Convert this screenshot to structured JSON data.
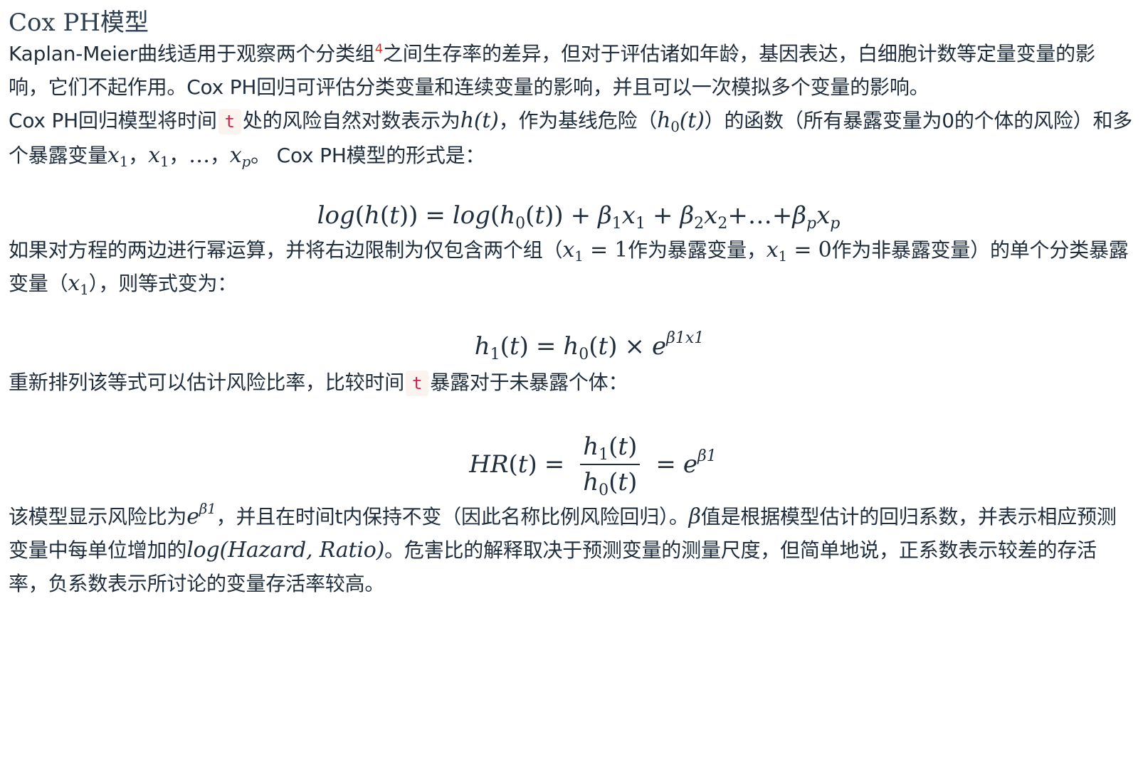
{
  "title": "Cox PH模型",
  "p1": {
    "a": "Kaplan-Meier曲线适用于观察两个分类组",
    "footnote": "4",
    "b": "之间生存率的差异，但对于评估诸如年龄，基因表达，白细胞计数等定量变量的影响，它们不起作用。Cox PH回归可评估分类变量和连续变量的影响，并且可以一次模拟多个变量的影响。"
  },
  "p2": {
    "a": "Cox PH回归模型将时间",
    "code": "t",
    "b": "处的风险自然对数表示为",
    "m1": "h(t)",
    "c": "，作为基线危险（",
    "m2_base": "h",
    "m2_sub": "0",
    "m2_tail": "(t)",
    "d": "）的函数（所有暴露变量为0的个体的风险）和多个暴露变量",
    "x": "x",
    "sub1": "1",
    "sep": "，",
    "dots": "…",
    "subp": "p",
    "e": "。 Cox PH模型的形式是："
  },
  "eq1": {
    "log": "log",
    "h": "h",
    "t": "t",
    "sub0": "0",
    "beta": "β",
    "x": "x",
    "s1": "1",
    "s2": "2",
    "sp": "p",
    "dots": "…"
  },
  "p3": {
    "a": "如果对方程的两边进行幂运算，并将右边限制为仅包含两个组（",
    "x": "x",
    "sub": "1",
    "eq": " = 1",
    "b": "作为暴露变量，",
    "eq0": " = 0",
    "c": "作为非暴露变量）的单个分类暴露变量（",
    "d": "），则等式变为："
  },
  "eq2": {
    "h": "h",
    "t": "t",
    "s1": "1",
    "s0": "0",
    "times": "×",
    "e": "e",
    "exp": "β1x1"
  },
  "p4": {
    "a": "重新排列该等式可以估计风险比率，比较时间",
    "code": "t",
    "b": "暴露对于未暴露个体："
  },
  "eq3": {
    "hr": "HR",
    "t": "t",
    "h": "h",
    "s1": "1",
    "s0": "0",
    "e": "e",
    "exp": "β1"
  },
  "p5": {
    "a": "该模型显示风险比为",
    "e": "e",
    "exp": "β1",
    "b": "，并且在时间t内保持不变（因此名称比例风险回归）。",
    "beta": "β",
    "c": "值是根据模型估计的回归系数，并表示相应预测变量中每单位增加的",
    "m": "log(Hazard, Ratio)",
    "d": "。危害比的解释取决于预测变量的测量尺度，但简单地说，正系数表示较差的存活率，负系数表示所讨论的变量存活率较高。"
  }
}
